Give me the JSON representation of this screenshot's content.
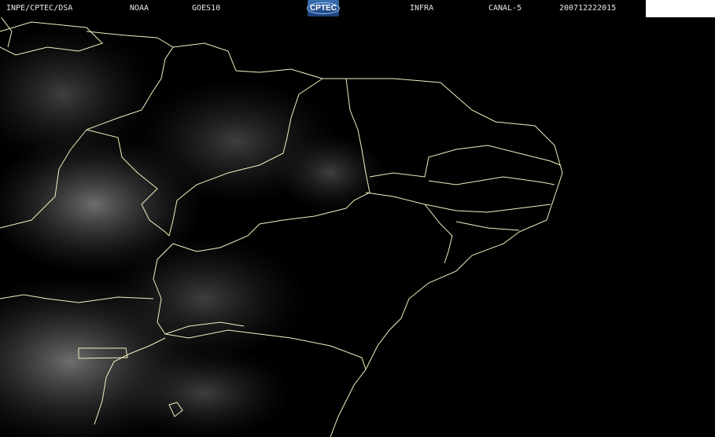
{
  "header": {
    "institution": "INPE/CPTEC/DSA",
    "agency": "NOAA",
    "satellite": "GOES10",
    "logo": "CPTEC",
    "product": "INFRA",
    "channel": "CANAL-5",
    "datetime": "200712222015"
  },
  "colors": {
    "background": "#000000",
    "borders": "#f4f0c0",
    "header_text": "#e8e8e8"
  }
}
